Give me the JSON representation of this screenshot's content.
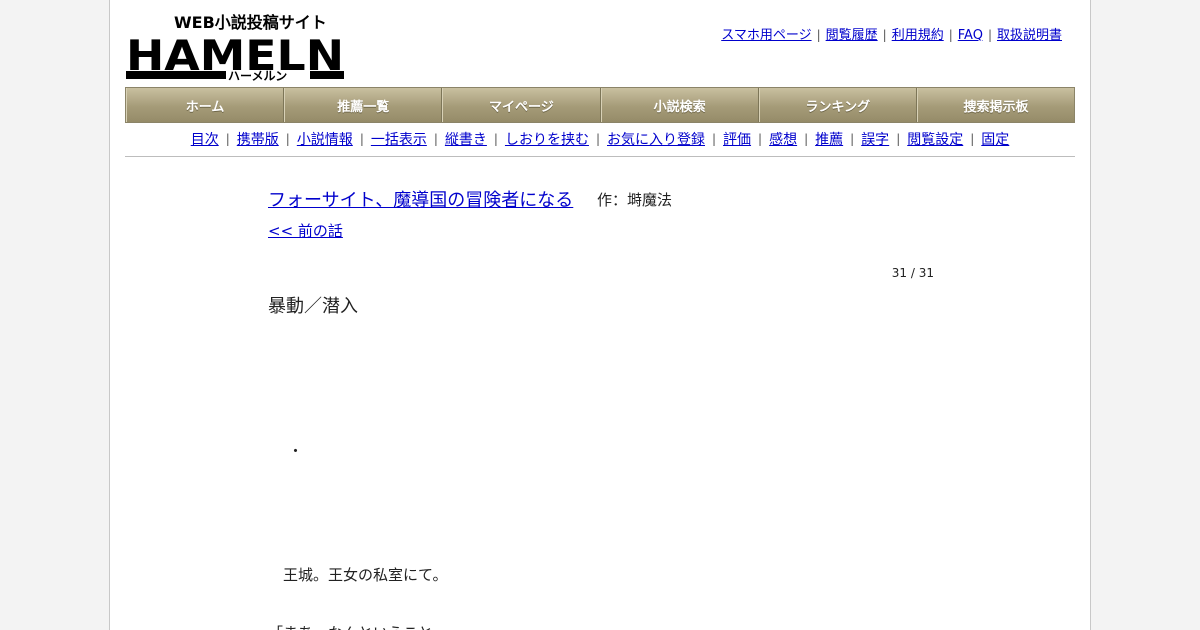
{
  "logo": {
    "text_main": "HAMELN",
    "text_top": "WEB小説投稿サイト",
    "text_sub": "ハーメルン"
  },
  "top_links": [
    "スマホ用ページ",
    "閲覧履歴",
    "利用規約",
    "FAQ",
    "取扱説明書"
  ],
  "main_nav": [
    "ホーム",
    "推薦一覧",
    "マイページ",
    "小説検索",
    "ランキング",
    "捜索掲示板"
  ],
  "sub_nav": [
    "目次",
    "携帯版",
    "小説情報",
    "一括表示",
    "縦書き",
    "しおりを挟む",
    "お気に入り登録",
    "評価",
    "感想",
    "推薦",
    "誤字",
    "閲覧設定",
    "固定"
  ],
  "novel": {
    "title": "フォーサイト、魔導国の冒険者になる",
    "author": "作：塒魔法",
    "prev_link": "<< 前の話",
    "page_count": "31 / 31",
    "chapter_title": "暴動／潜入",
    "body_lines": [
      "・",
      "王城。王女の私室にて。",
      "「まあ、なんということ"
    ]
  },
  "colors": {
    "nav_gradient_top": "#c9c0a0",
    "nav_gradient_bottom": "#958b68",
    "link": "#0000cc"
  }
}
